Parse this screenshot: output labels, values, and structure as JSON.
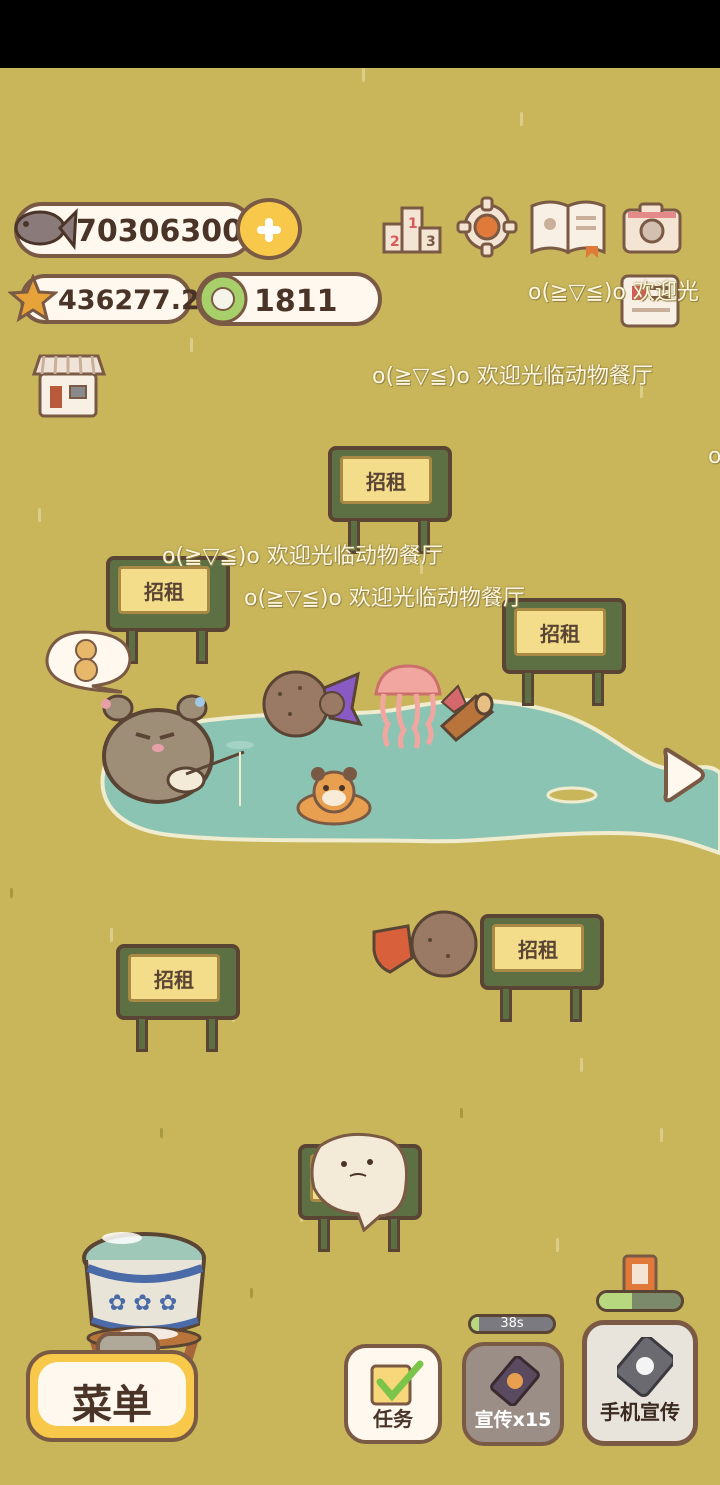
{
  "currency": {
    "fish": "70306300",
    "star": "436277.2",
    "gem": "1811"
  },
  "signs": {
    "rent_label": "招租"
  },
  "greetings": {
    "welcome_full": "o(≧▽≦)o 欢迎光临动物餐厅",
    "welcome_partial": "o(≧▽≦)o 欢迎光",
    "edge_char": "o"
  },
  "bottom": {
    "menu_label": "菜单",
    "task_label": "任务",
    "promo_label": "宣传x15",
    "promo_timer": "38s",
    "phone_promo_label": "手机宣传"
  },
  "icons": {
    "fish": "fish-icon",
    "star": "star-icon",
    "gem": "gem-icon",
    "ranking": "podium-ranking-icon",
    "settings": "gear-icon",
    "book": "recipe-book-icon",
    "camera": "camera-icon",
    "news": "newspaper-icon",
    "shop": "shop-icon",
    "next": "arrow-right-icon"
  },
  "colors": {
    "ground": "#c9b65a",
    "pond": "#8cc4b4",
    "accent_yellow": "#f7c84a",
    "outline": "#7a5a44"
  },
  "promo_progress": 0.1,
  "phone_progress": 0.4
}
